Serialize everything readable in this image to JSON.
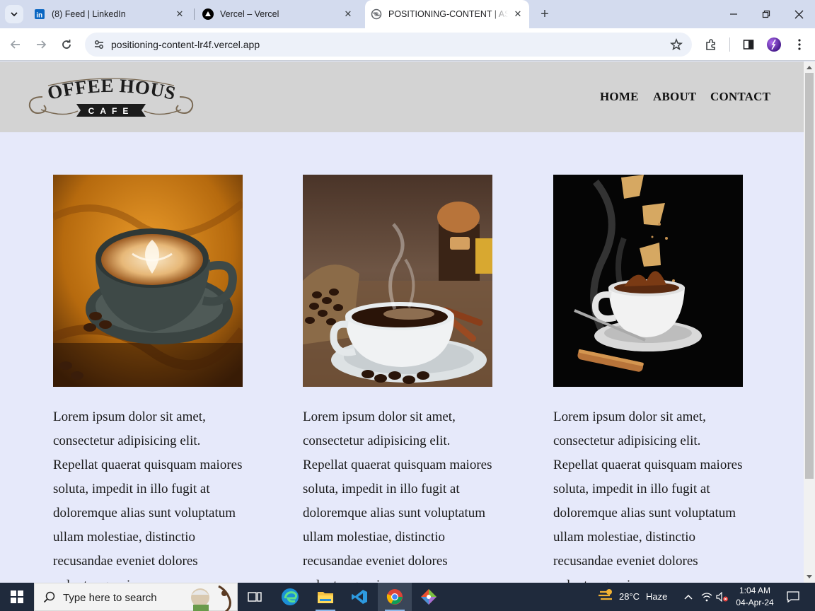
{
  "browser": {
    "tabs": [
      {
        "title": "(8) Feed | LinkedIn",
        "favicon": "linkedin-icon"
      },
      {
        "title": "Vercel – Vercel",
        "favicon": "vercel-icon"
      },
      {
        "title": "POSITIONING-CONTENT | ASSIGNMENT",
        "favicon": "globe-icon",
        "active": true
      }
    ],
    "url": "positioning-content-lr4f.vercel.app"
  },
  "site": {
    "logo": {
      "main": "COFFEE HOUSE",
      "sub": "CAFE"
    },
    "nav": [
      {
        "label": "HOME"
      },
      {
        "label": "ABOUT"
      },
      {
        "label": "CONTACT"
      }
    ],
    "cards": [
      {
        "image": "latte-art-cup-on-orange-cloth",
        "text": "Lorem ipsum dolor sit amet, consectetur adipisicing elit. Repellat quaerat quisquam maiores soluta, impedit in illo fugit at doloremque alias sunt voluptatum ullam molestiae, distinctio recusandae eveniet dolores voluptas quasi."
      },
      {
        "image": "steaming-coffee-cup-with-beans-and-grinder",
        "text": "Lorem ipsum dolor sit amet, consectetur adipisicing elit. Repellat quaerat quisquam maiores soluta, impedit in illo fugit at doloremque alias sunt voluptatum ullam molestiae, distinctio recusandae eveniet dolores voluptas quasi."
      },
      {
        "image": "splashing-coffee-cup-on-black",
        "text": "Lorem ipsum dolor sit amet, consectetur adipisicing elit. Repellat quaerat quisquam maiores soluta, impedit in illo fugit at doloremque alias sunt voluptatum ullam molestiae, distinctio recusandae eveniet dolores voluptas quasi."
      }
    ]
  },
  "taskbar": {
    "search_placeholder": "Type here to search",
    "weather": {
      "temp": "28°C",
      "condition": "Haze"
    },
    "time": "1:04 AM",
    "date": "04-Apr-24"
  },
  "colors": {
    "header_bg": "#d3d3d3",
    "page_bg": "#e6e9fa",
    "taskbar_bg": "#1f2a3c"
  }
}
